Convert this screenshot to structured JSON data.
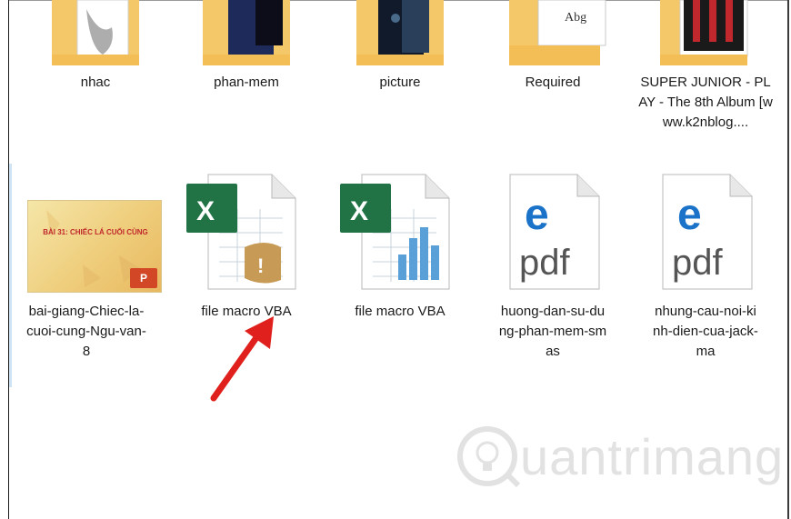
{
  "folders": [
    {
      "name": "nhac"
    },
    {
      "name": "phan-mem"
    },
    {
      "name": "picture"
    },
    {
      "name": "Required",
      "thumb_text": "Abg"
    },
    {
      "name": "SUPER JUNIOR - PLAY - The 8th Album [www.k2nblog...."
    }
  ],
  "files": [
    {
      "name": "bai-giang-Chiec-la-cuoi-cung-Ngu-van-8",
      "thumb_title": "BÀI 31: CHIẾC LÁ CUỐI CÙNG",
      "type": "powerpoint"
    },
    {
      "name": "file macro VBA",
      "type": "excel-macro"
    },
    {
      "name": "file macro VBA",
      "type": "excel"
    },
    {
      "name": "huong-dan-su-dung-phan-mem-smas",
      "type": "pdf",
      "type_text": "pdf"
    },
    {
      "name": "nhung-cau-noi-kinh-dien-cua-jack-ma",
      "type": "pdf",
      "type_text": "pdf"
    }
  ],
  "watermark": {
    "text": "uantrimang"
  },
  "colors": {
    "folder": "#f4c869",
    "excel_green": "#217346",
    "edge_blue": "#1a73c8",
    "arrow_red": "#e0201c"
  }
}
